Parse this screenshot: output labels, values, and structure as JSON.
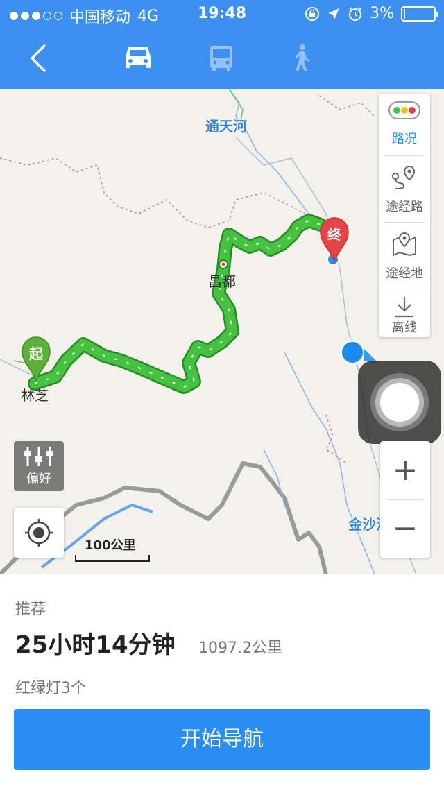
{
  "status_bar": {
    "carrier": "中国移动",
    "network": "4G",
    "time": "19:48",
    "battery_percent": "3%",
    "battery_level": 0.03,
    "signal_bars_filled": 3,
    "signal_bars_total": 5
  },
  "nav": {
    "back_icon": "chevron-left-icon",
    "modes": [
      "car-icon",
      "bus-icon",
      "walk-icon"
    ],
    "selected_mode": "car"
  },
  "map": {
    "labels": {
      "tongtianhe": "通天河",
      "changdu": "昌都",
      "linzhi": "林芝",
      "jinshajiang": "金沙江"
    },
    "start_pin": "起",
    "end_pin": "终",
    "scale_label": "100公里",
    "preference_label": "偏好"
  },
  "controls": {
    "traffic_label": "路况",
    "waypoint_route_label": "途经路",
    "waypoint_place_label": "途经地",
    "offline_label": "离线",
    "zoom_in": "+",
    "zoom_out": "−"
  },
  "route": {
    "recommend_label": "推荐",
    "duration": "25小时14分钟",
    "distance": "1097.2公里",
    "traffic_lights": "红绿灯3个",
    "start_button": "开始导航"
  },
  "colors": {
    "header_blue": "#3d8ff2",
    "route_green": "#3db83a",
    "button_blue": "#2a8df5"
  }
}
